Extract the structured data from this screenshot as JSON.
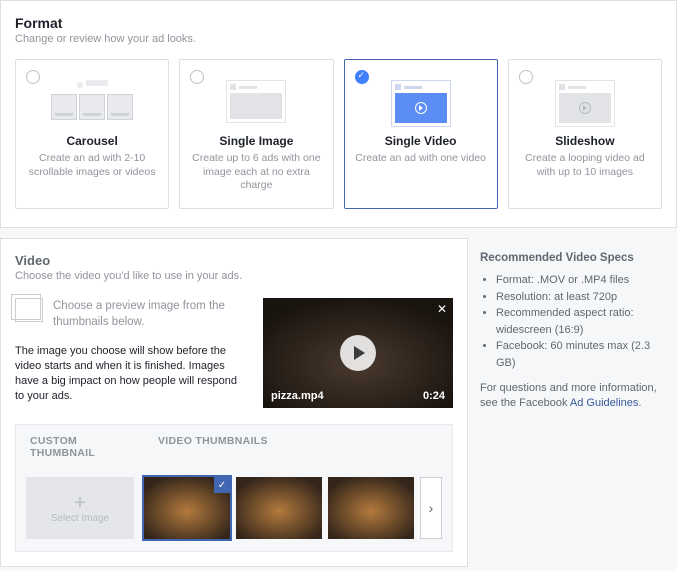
{
  "format": {
    "title": "Format",
    "subtitle": "Change or review how your ad looks.",
    "options": [
      {
        "title": "Carousel",
        "desc": "Create an ad with 2-10 scrollable images or videos",
        "selected": false
      },
      {
        "title": "Single Image",
        "desc": "Create up to 6 ads with one image each at no extra charge",
        "selected": false
      },
      {
        "title": "Single Video",
        "desc": "Create an ad with one video",
        "selected": true
      },
      {
        "title": "Slideshow",
        "desc": "Create a looping video ad with up to 10 images",
        "selected": false
      }
    ]
  },
  "video": {
    "title": "Video",
    "subtitle": "Choose the video you'd like to use in your ads.",
    "instruction": "Choose a preview image from the thumbnails below.",
    "note": "The image you choose will show before the video starts and when it is finished. Images have a big impact on how people will respond to your ads.",
    "player": {
      "filename": "pizza.mp4",
      "duration": "0:24"
    }
  },
  "thumbs": {
    "tab_custom": "CUSTOM THUMBNAIL",
    "tab_video": "VIDEO THUMBNAILS",
    "custom_label": "Select Image"
  },
  "specs": {
    "title": "Recommended Video Specs",
    "items": [
      "Format: .MOV or .MP4 files",
      "Resolution: at least 720p",
      "Recommended aspect ratio: widescreen (16:9)",
      "Facebook: 60 minutes max (2.3 GB)"
    ],
    "note_prefix": "For questions and more information, see the Facebook ",
    "note_link": "Ad Guidelines",
    "note_suffix": "."
  }
}
